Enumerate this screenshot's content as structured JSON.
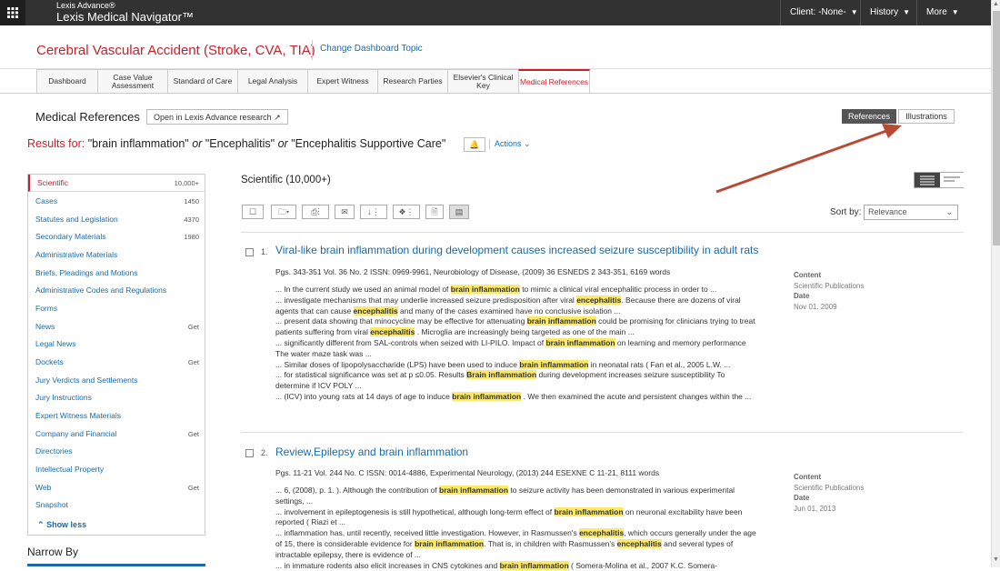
{
  "topbar": {
    "brand_small": "Lexis Advance®",
    "brand_large": "Lexis Medical Navigator™",
    "nav": [
      {
        "label": "Client: -None-"
      },
      {
        "label": "History"
      },
      {
        "label": "More"
      }
    ]
  },
  "header": {
    "topic": "Cerebral Vascular Accident (Stroke, CVA, TIA)",
    "change_link": "Change Dashboard Topic"
  },
  "tabs": [
    {
      "label": "Dashboard"
    },
    {
      "label": "Case Value Assessment"
    },
    {
      "label": "Standard of Care"
    },
    {
      "label": "Legal Analysis"
    },
    {
      "label": "Expert Witness"
    },
    {
      "label": "Research Parties"
    },
    {
      "label": "Elsevier's Clinical Key"
    },
    {
      "label": "Medical References"
    }
  ],
  "section": {
    "title": "Medical References",
    "open_button": "Open in Lexis Advance research",
    "toggle_references": "References",
    "toggle_illustrations": "Illustrations"
  },
  "results": {
    "label": "Results for:",
    "term1": "\"brain inflammation\"",
    "or1": "or",
    "term2": "\"Encephalitis\"",
    "or2": "or",
    "term3": "\"Encephalitis Supportive Care\"",
    "actions": "Actions"
  },
  "sidebar": {
    "items": [
      {
        "label": "Scientific",
        "count": "10,000+"
      },
      {
        "label": "Cases",
        "count": "1450"
      },
      {
        "label": "Statutes and Legislation",
        "count": "4370"
      },
      {
        "label": "Secondary Materials",
        "count": "1980"
      },
      {
        "label": "Administrative Materials",
        "count": ""
      },
      {
        "label": "Briefs, Pleadings and Motions",
        "count": ""
      },
      {
        "label": "Administrative Codes and Regulations",
        "count": ""
      },
      {
        "label": "Forms",
        "count": ""
      },
      {
        "label": "News",
        "count": "Get"
      },
      {
        "label": "Legal News",
        "count": ""
      },
      {
        "label": "Dockets",
        "count": "Get"
      },
      {
        "label": "Jury Verdicts and Settlements",
        "count": ""
      },
      {
        "label": "Jury Instructions",
        "count": ""
      },
      {
        "label": "Expert Witness Materials",
        "count": ""
      },
      {
        "label": "Company and Financial",
        "count": "Get"
      },
      {
        "label": "Directories",
        "count": ""
      },
      {
        "label": "Intellectual Property",
        "count": ""
      },
      {
        "label": "Web",
        "count": "Get"
      },
      {
        "label": "Snapshot",
        "count": ""
      }
    ],
    "show_less": "Show less",
    "narrow_by": "Narrow By"
  },
  "main": {
    "heading": "Scientific (10,000+)",
    "sort_label": "Sort by:",
    "sort_value": "Relevance"
  },
  "result_items": [
    {
      "num": "1.",
      "title": "Viral-like brain inflammation during development causes increased seizure susceptibility in adult rats",
      "meta": "Pgs. 343-351 Vol. 36 No. 2 ISSN: 0969-9961, Neurobiology of Disease, (2009) 36 ESNEDS 2 343-351, 6169 words",
      "content_label": "Content",
      "content_value": "Scientific Publications",
      "date_label": "Date",
      "date_value": "Nov 01, 2009"
    },
    {
      "num": "2.",
      "title": "Review,Epilepsy and brain inflammation",
      "meta": "Pgs. 11-21 Vol. 244 No. C ISSN: 0014-4886, Experimental Neurology, (2013) 244 ESEXNE C 11-21, 8111 words",
      "content_label": "Content",
      "content_value": "Scientific Publications",
      "date_label": "Date",
      "date_value": "Jun 01, 2013"
    }
  ],
  "colors": {
    "brand_red": "#c8202b",
    "link_blue": "#1a6aa5",
    "highlight": "#fde968",
    "topbar": "#323232"
  }
}
